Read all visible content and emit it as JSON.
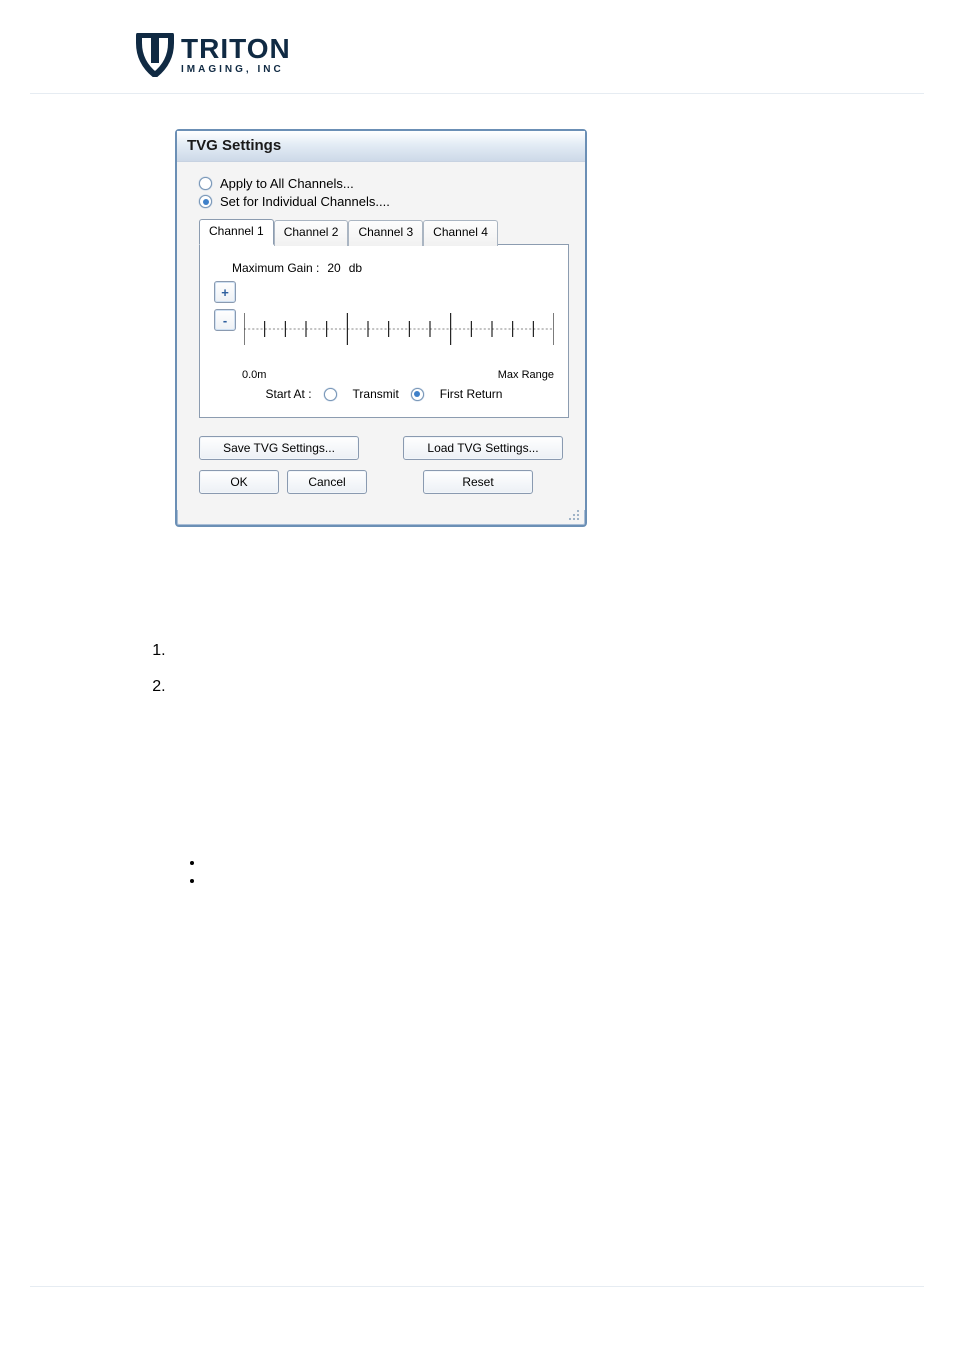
{
  "brand": {
    "name": "TRITON",
    "tagline": "IMAGING,  INC"
  },
  "dialog": {
    "title": "TVG Settings",
    "apply_all": "Apply to All Channels...",
    "set_individual": "Set for Individual Channels....",
    "tabs": [
      "Channel 1",
      "Channel 2",
      "Channel 3",
      "Channel 4"
    ],
    "max_gain_label": "Maximum Gain :",
    "max_gain_value": "20",
    "max_gain_unit": "db",
    "plus": "+",
    "minus": "-",
    "range_start": "0.0m",
    "range_end": "Max Range",
    "start_at_label": "Start At :",
    "start_at_transmit": "Transmit",
    "start_at_first_return": "First Return",
    "save_btn": "Save TVG Settings...",
    "load_btn": "Load TVG Settings...",
    "ok_btn": "OK",
    "cancel_btn": "Cancel",
    "reset_btn": "Reset"
  },
  "list": {
    "n1": "",
    "n2": "",
    "b1": "",
    "b2": ""
  }
}
